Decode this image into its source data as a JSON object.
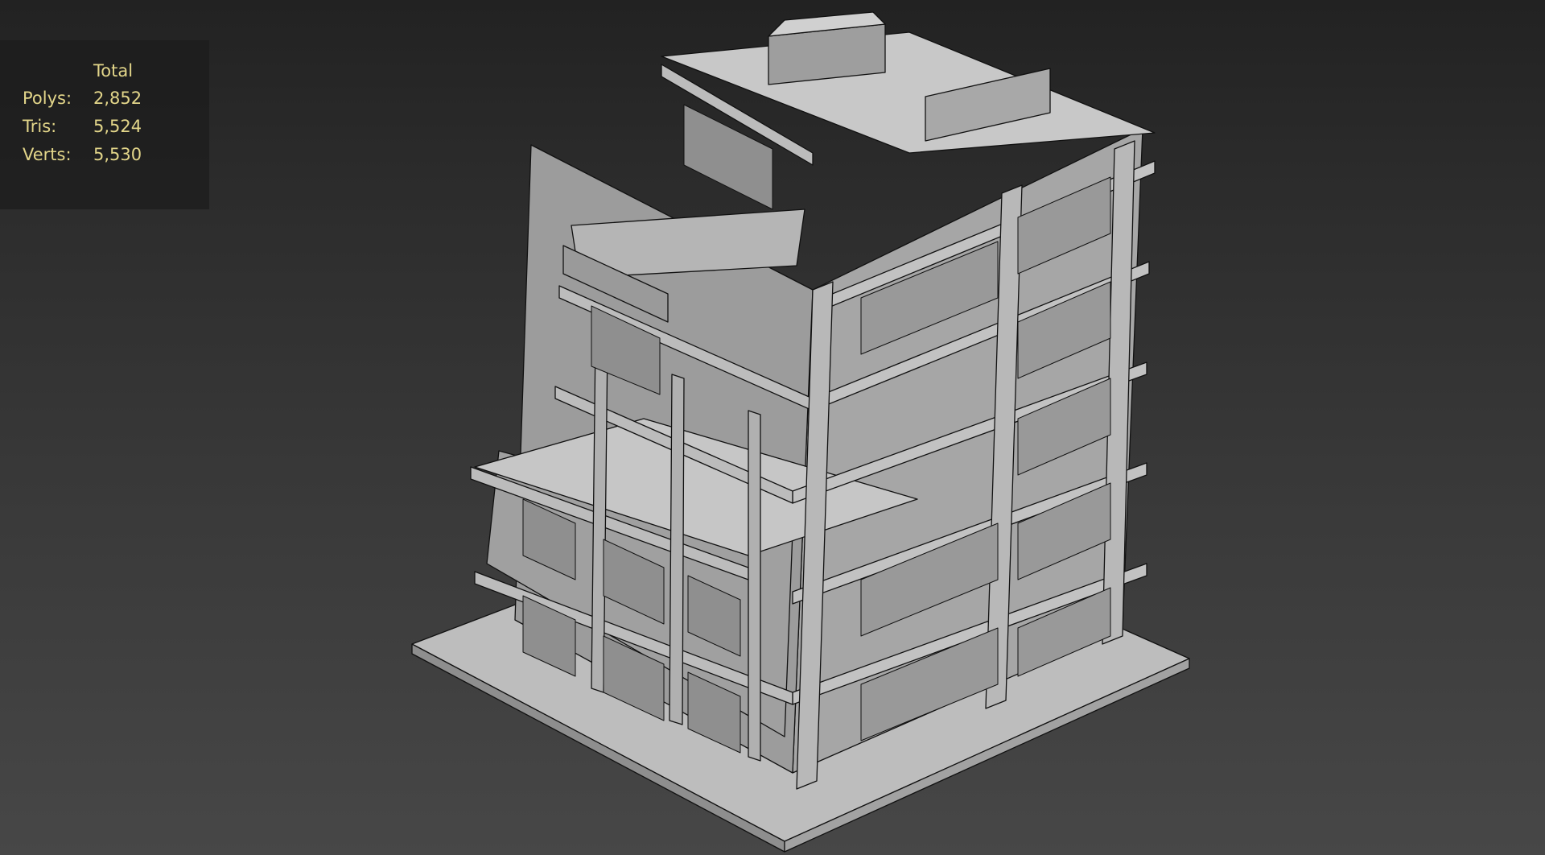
{
  "stats": {
    "header": "Total",
    "rows": [
      {
        "label": "Polys:",
        "value": "2,852"
      },
      {
        "label": "Tris:",
        "value": "5,524"
      },
      {
        "label": "Verts:",
        "value": "5,530"
      }
    ]
  },
  "colors": {
    "face_light": "#c9c9c9",
    "face_mid": "#aaaaaa",
    "face_dark": "#8f8f8f",
    "edge": "#111111",
    "stats_text": "#e3d68a"
  }
}
